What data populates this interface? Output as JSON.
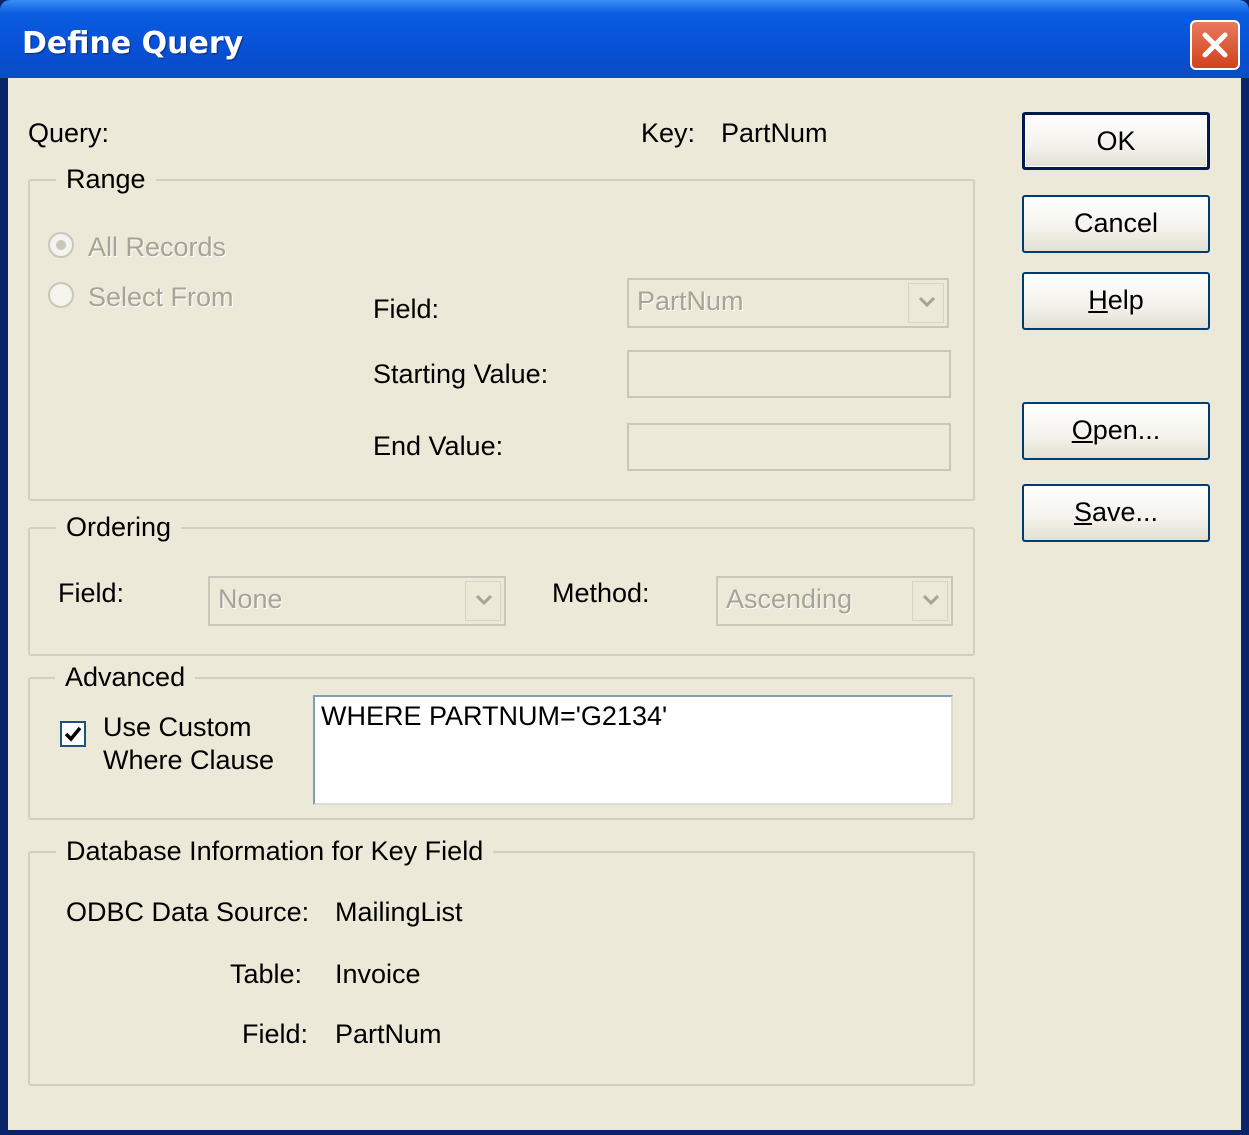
{
  "window": {
    "title": "Define Query"
  },
  "header": {
    "query_label": "Query:",
    "key_label": "Key:",
    "key_value": "PartNum"
  },
  "range": {
    "legend": "Range",
    "all_records": "All Records",
    "select_from": "Select From",
    "field_label": "Field:",
    "field_value": "PartNum",
    "starting_value_label": "Starting Value:",
    "starting_value": "",
    "end_value_label": "End Value:",
    "end_value": "",
    "selected_option": "All Records"
  },
  "ordering": {
    "legend": "Ordering",
    "field_label": "Field:",
    "field_value": "None",
    "method_label": "Method:",
    "method_value": "Ascending"
  },
  "advanced": {
    "legend": "Advanced",
    "use_custom_line1": "Use Custom",
    "use_custom_line2": "Where Clause",
    "use_custom_checked": true,
    "where_clause": "WHERE PARTNUM='G2134'"
  },
  "dbinfo": {
    "legend": "Database Information for Key Field",
    "odbc_label": "ODBC Data Source:",
    "odbc_value": "MailingList",
    "table_label": "Table:",
    "table_value": "Invoice",
    "field_label": "Field:",
    "field_value": "PartNum"
  },
  "buttons": {
    "ok": "OK",
    "cancel": "Cancel",
    "help_u": "H",
    "help_rest": "elp",
    "open_u": "O",
    "open_rest": "pen...",
    "save_u": "S",
    "save_rest": "ave..."
  },
  "colors": {
    "title_bar": "#0a5ce0",
    "dialog_bg": "#ece9d8",
    "close_button": "#d1421b"
  },
  "icons": {
    "close": "close-x-icon",
    "dropdown": "chevron-down-icon",
    "check": "checkmark-icon"
  }
}
